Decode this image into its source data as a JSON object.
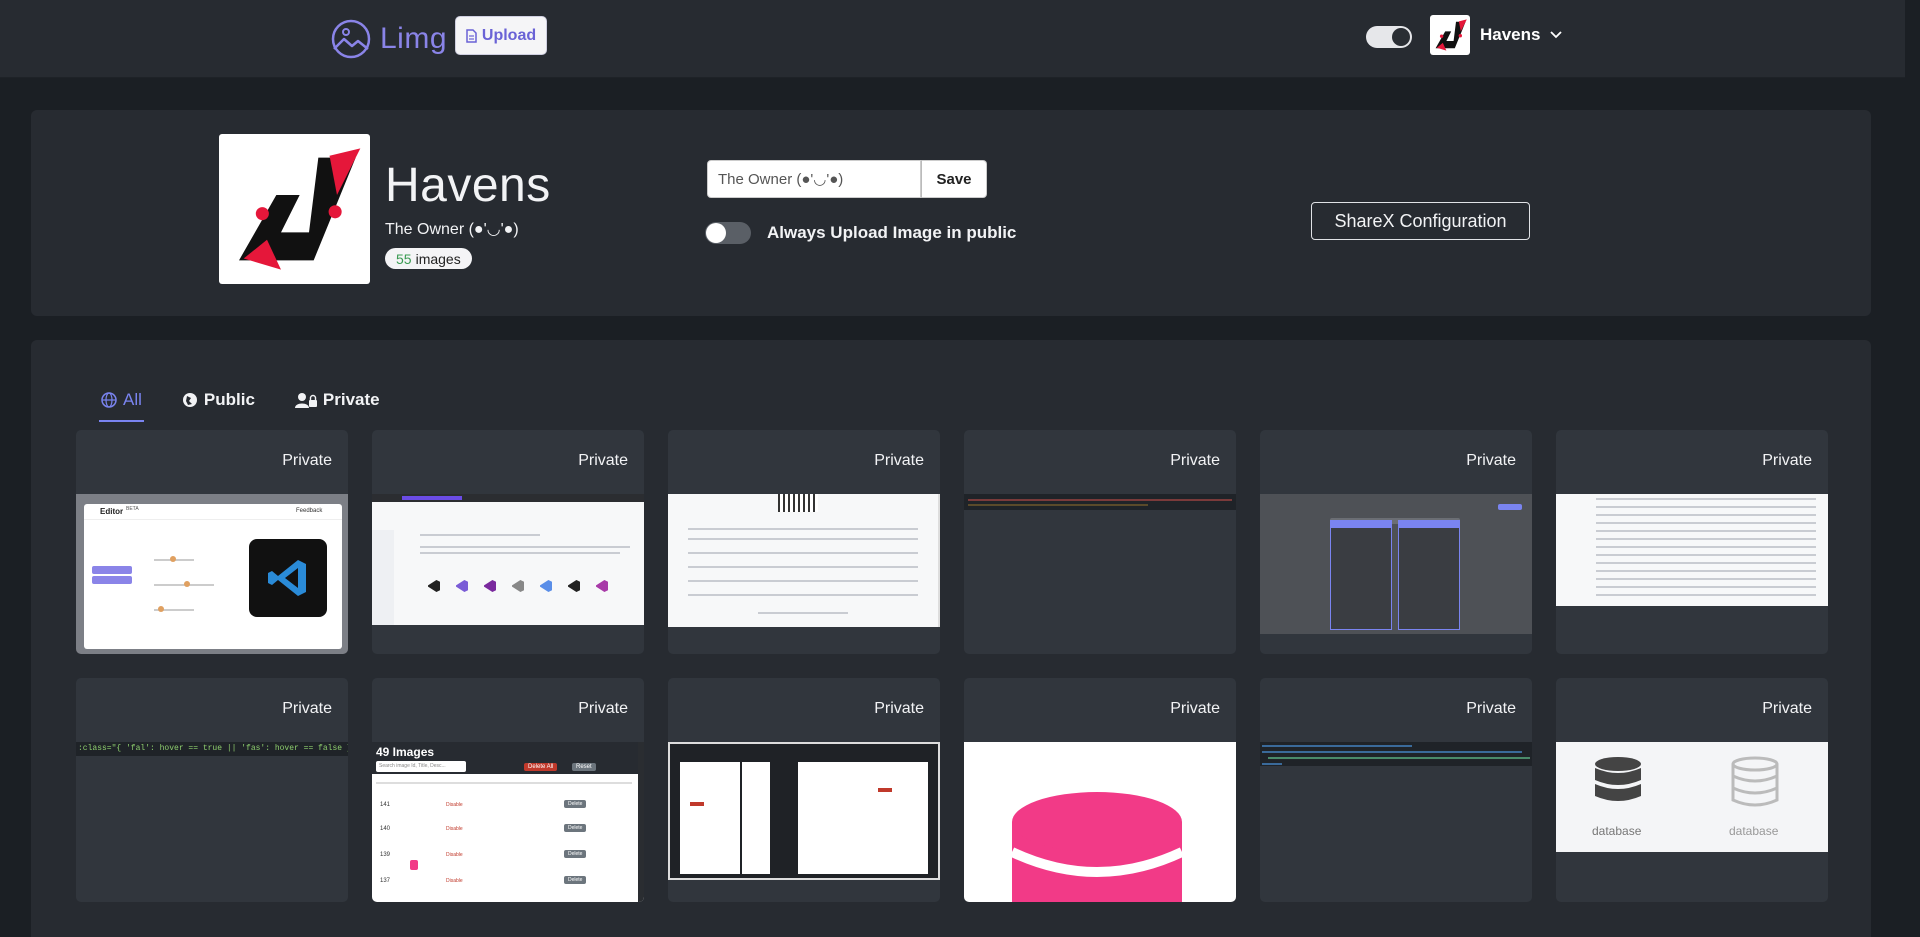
{
  "app": {
    "logo_text": "Limg",
    "upload_label": "Upload",
    "user_name": "Havens"
  },
  "profile": {
    "name": "Havens",
    "title": "The Owner (●'◡'●)",
    "image_count": "55",
    "image_count_suffix": "images",
    "title_input_value": "The Owner (●'◡'●)",
    "save_label": "Save",
    "public_toggle_label": "Always Upload Image in public",
    "public_toggle_on": false,
    "sharex_label": "ShareX Configuration"
  },
  "tabs": [
    {
      "label": "All",
      "icon": "globe-icon",
      "active": true
    },
    {
      "label": "Public",
      "icon": "public-icon",
      "active": false
    },
    {
      "label": "Private",
      "icon": "user-lock-icon",
      "active": false
    }
  ],
  "cards": [
    {
      "badge": "Private",
      "thumb": "editor-screenshot"
    },
    {
      "badge": "Private",
      "thumb": "vscode-icons-screenshot"
    },
    {
      "badge": "Private",
      "thumb": "form-screenshot"
    },
    {
      "badge": "Private",
      "thumb": "code-dark-screenshot"
    },
    {
      "badge": "Private",
      "thumb": "dropdowns-screenshot"
    },
    {
      "badge": "Private",
      "thumb": "file-list-screenshot"
    },
    {
      "badge": "Private",
      "thumb": "code-snippet-screenshot"
    },
    {
      "badge": "Private",
      "thumb": "images-table-screenshot"
    },
    {
      "badge": "Private",
      "thumb": "dual-panel-screenshot"
    },
    {
      "badge": "Private",
      "thumb": "pink-database-icon"
    },
    {
      "badge": "Private",
      "thumb": "code-html-screenshot"
    },
    {
      "badge": "Private",
      "thumb": "database-icons"
    }
  ],
  "thumb_text": {
    "editor_title": "Editor",
    "editor_beta": "BETA",
    "editor_feedback": "Feedback",
    "images_table_title": "49 Images",
    "images_delete_all": "Delete All",
    "images_reset": "Reset",
    "images_search_placeholder": "Search image Id, Title, Desc...",
    "images_row_ids": [
      "141",
      "140",
      "139",
      "137"
    ],
    "images_row_status": "Disable",
    "images_row_action": "Delete",
    "db_label_1": "database",
    "db_label_2": "database",
    "code_snippet": ":class=\"{ 'fal': hover == true || 'fas': hover == false }\">"
  },
  "colors": {
    "accent": "#7a84f0",
    "logo": "#8a84e8",
    "count_green": "#3a9b52",
    "pink": "#f23a87"
  }
}
